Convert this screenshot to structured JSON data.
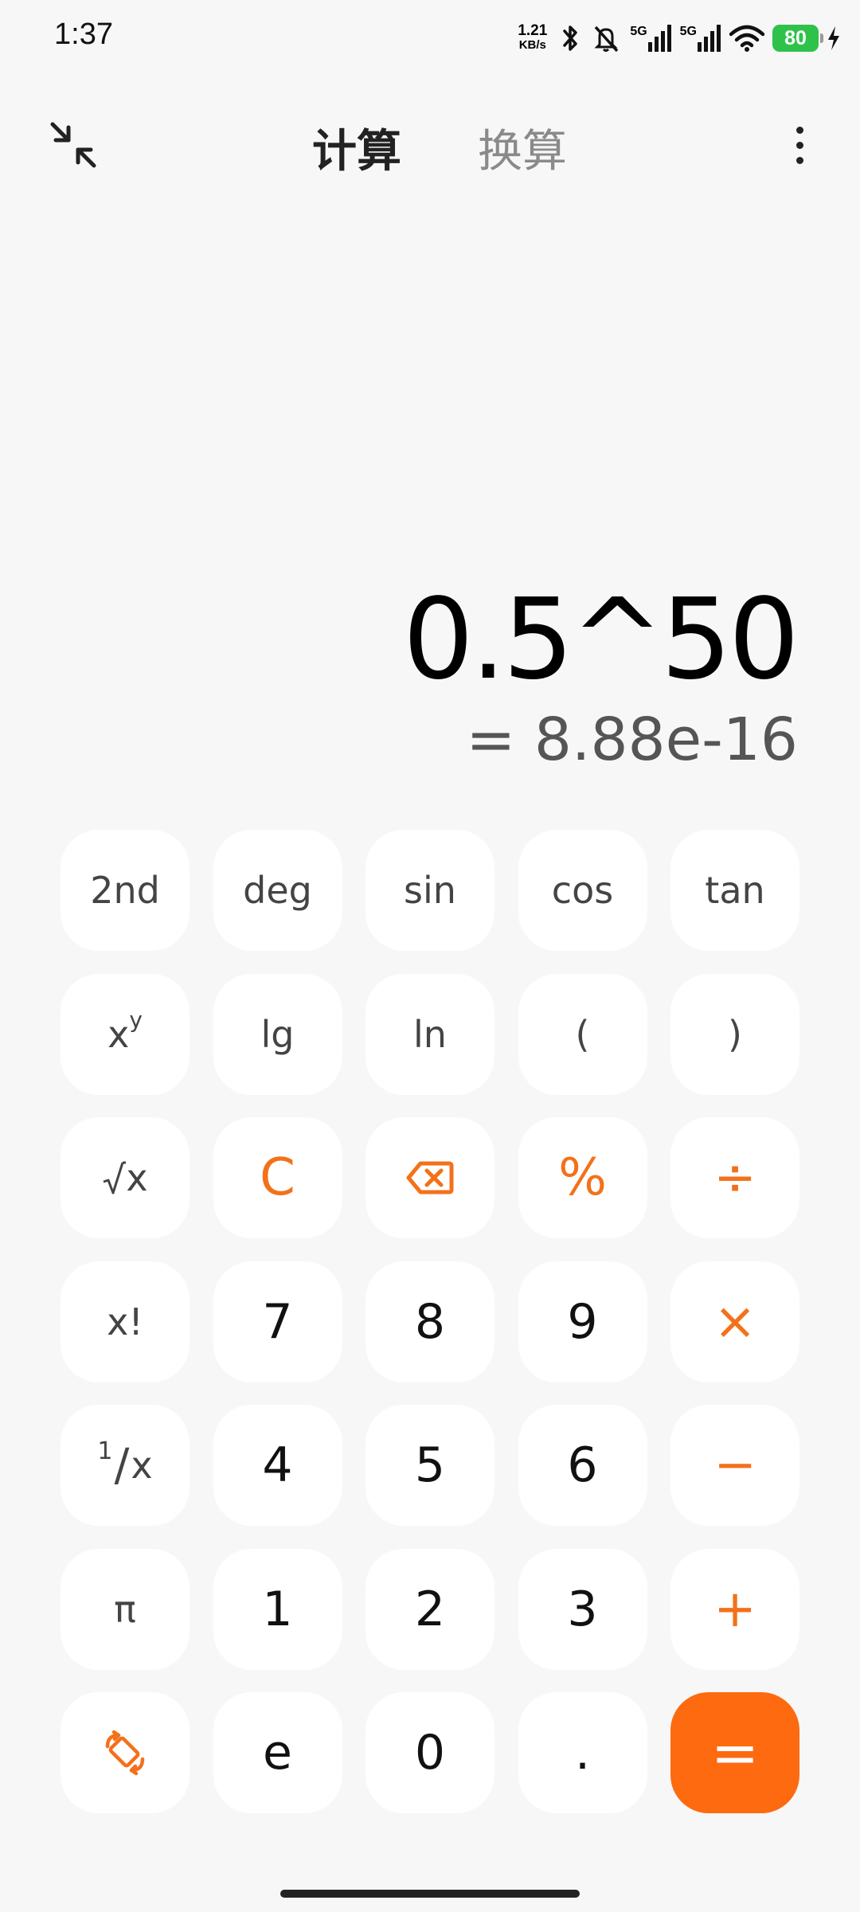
{
  "status_bar": {
    "time": "1:37",
    "net_speed_value": "1.21",
    "net_speed_unit": "KB/s",
    "sig1_label": "5G",
    "sig2_label": "5G",
    "battery": "80"
  },
  "top_bar": {
    "tabs": [
      {
        "label": "计算"
      },
      {
        "label": "换算"
      }
    ]
  },
  "display": {
    "expression": "0.5^50",
    "result": "= 8.88e-16"
  },
  "keypad": {
    "row1": [
      "2nd",
      "deg",
      "sin",
      "cos",
      "tan"
    ],
    "row2": {
      "xy_base": "x",
      "xy_exp": "y",
      "lg": "lg",
      "ln": "ln",
      "lparen": "(",
      "rparen": ")"
    },
    "row3": {
      "sqrt_x": "x",
      "clear": "C",
      "percent": "%",
      "divide": "÷"
    },
    "row4": {
      "factorial": "x!",
      "seven": "7",
      "eight": "8",
      "nine": "9",
      "multiply": "×"
    },
    "row5": {
      "recip_num": "1",
      "recip_den": "x",
      "four": "4",
      "five": "5",
      "six": "6",
      "minus": "−"
    },
    "row6": {
      "pi": "π",
      "one": "1",
      "two": "2",
      "three": "3",
      "plus": "+"
    },
    "row7": {
      "e": "e",
      "zero": "0",
      "dot": ".",
      "equals": "="
    }
  },
  "colors": {
    "accent": "#f3711a",
    "equals_bg": "#fd6a10",
    "key_bg": "#ffffff",
    "page_bg": "#f7f7f7"
  }
}
